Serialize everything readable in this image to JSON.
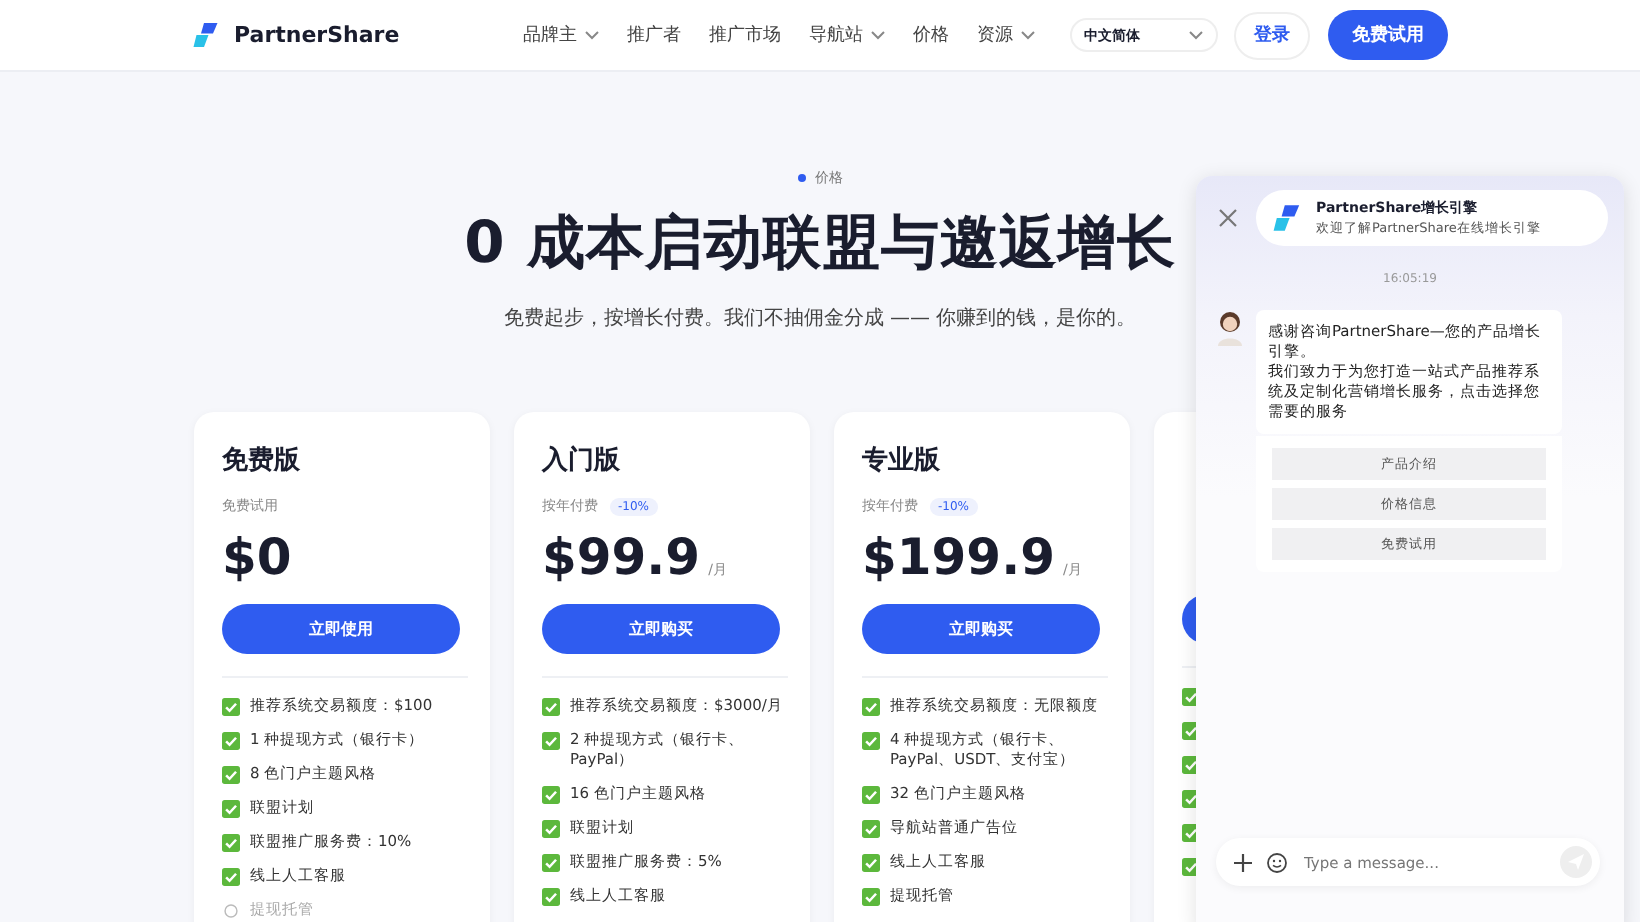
{
  "header": {
    "brand": "PartnerShare",
    "nav": [
      {
        "label": "品牌主",
        "dropdown": true
      },
      {
        "label": "推广者",
        "dropdown": false
      },
      {
        "label": "推广市场",
        "dropdown": false
      },
      {
        "label": "导航站",
        "dropdown": true
      },
      {
        "label": "价格",
        "dropdown": false
      },
      {
        "label": "资源",
        "dropdown": true
      }
    ],
    "language": "中文简体",
    "login": "登录",
    "signup": "免费试用"
  },
  "hero": {
    "eyebrow": "价格",
    "title": "0 成本启动联盟与邀返增长",
    "subtitle": "免费起步，按增长付费。我们不抽佣金分成 —— 你赚到的钱，是你的。"
  },
  "plans": [
    {
      "title": "免费版",
      "billing": "免费试用",
      "price": "$0",
      "button": "立即使用",
      "features": [
        {
          "text": "推荐系统交易额度：$100",
          "checked": true
        },
        {
          "text": "1 种提现方式（银行卡）",
          "checked": true
        },
        {
          "text": "8 色门户主题风格",
          "checked": true
        },
        {
          "text": "联盟计划",
          "checked": true
        },
        {
          "text": "联盟推广服务费：10%",
          "checked": true
        },
        {
          "text": "线上人工客服",
          "checked": true
        },
        {
          "text": "提现托管",
          "checked": false
        }
      ]
    },
    {
      "title": "入门版",
      "billing": "按年付费",
      "discount": "-10%",
      "price": "$99.9",
      "unit": "/月",
      "button": "立即购买",
      "features": [
        {
          "text": "推荐系统交易额度：$3000/月",
          "checked": true
        },
        {
          "text": "2 种提现方式（银行卡、PayPal）",
          "checked": true
        },
        {
          "text": "16 色门户主题风格",
          "checked": true
        },
        {
          "text": "联盟计划",
          "checked": true
        },
        {
          "text": "联盟推广服务费：5%",
          "checked": true
        },
        {
          "text": "线上人工客服",
          "checked": true
        }
      ]
    },
    {
      "title": "专业版",
      "billing": "按年付费",
      "discount": "-10%",
      "price": "$199.9",
      "unit": "/月",
      "button": "立即购买",
      "features": [
        {
          "text": "推荐系统交易额度：无限额度",
          "checked": true
        },
        {
          "text": "4 种提现方式（银行卡、PayPal、USDT、支付宝）",
          "checked": true
        },
        {
          "text": "32 色门户主题风格",
          "checked": true
        },
        {
          "text": "导航站普通广告位",
          "checked": true
        },
        {
          "text": "线上人工客服",
          "checked": true
        },
        {
          "text": "提现托管",
          "checked": true
        }
      ]
    },
    {
      "features": [
        {
          "checked": true
        },
        {
          "checked": true
        },
        {
          "checked": true
        },
        {
          "checked": true
        },
        {
          "checked": true
        },
        {
          "checked": true
        }
      ]
    }
  ],
  "chat": {
    "title": "PartnerShare增长引擎",
    "subtitle": "欢迎了解PartnerShare在线增长引擎",
    "time": "16:05:19",
    "message": [
      "感谢咨询PartnerShare—您的产品增长引擎。",
      "我们致力于为您打造一站式产品推荐系统及定制化营销增长服务，点击选择您需要的服务"
    ],
    "options": [
      "产品介绍",
      "价格信息",
      "免费试用"
    ],
    "input": {
      "placeholder": "Type a message..."
    }
  }
}
